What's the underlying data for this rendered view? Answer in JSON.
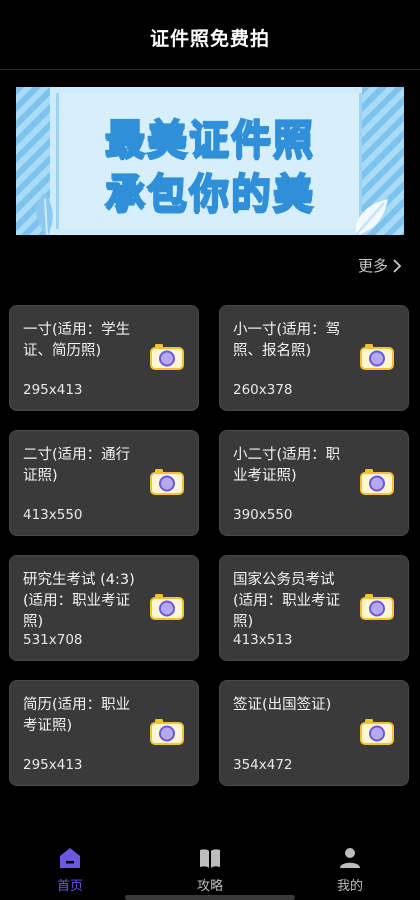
{
  "header": {
    "title": "证件照免费拍"
  },
  "banner": {
    "line1": "最美证件照",
    "line2": "承包你的美"
  },
  "more_label": "更多",
  "cards": [
    {
      "name": "一寸(适用：学生证、简历照)",
      "size": "295x413"
    },
    {
      "name": "小一寸(适用：驾照、报名照)",
      "size": "260x378"
    },
    {
      "name": "二寸(适用：通行证照)",
      "size": "413x550"
    },
    {
      "name": "小二寸(适用：职业考证照)",
      "size": "390x550"
    },
    {
      "name": "研究生考试 (4:3) (适用：职业考证照)",
      "size": "531x708"
    },
    {
      "name": "国家公务员考试 (适用：职业考证照)",
      "size": "413x513"
    },
    {
      "name": "简历(适用：职业考证照)",
      "size": "295x413"
    },
    {
      "name": "签证(出国签证)",
      "size": "354x472"
    }
  ],
  "tabs": [
    {
      "label": "首页",
      "icon": "home-icon",
      "active": true
    },
    {
      "label": "攻略",
      "icon": "book-icon",
      "active": false
    },
    {
      "label": "我的",
      "icon": "profile-icon",
      "active": false
    }
  ],
  "colors": {
    "accent": "#6a58e0",
    "card_bg": "#3a3a3a",
    "background": "#000000",
    "banner_blue": "#2f8fd8"
  }
}
